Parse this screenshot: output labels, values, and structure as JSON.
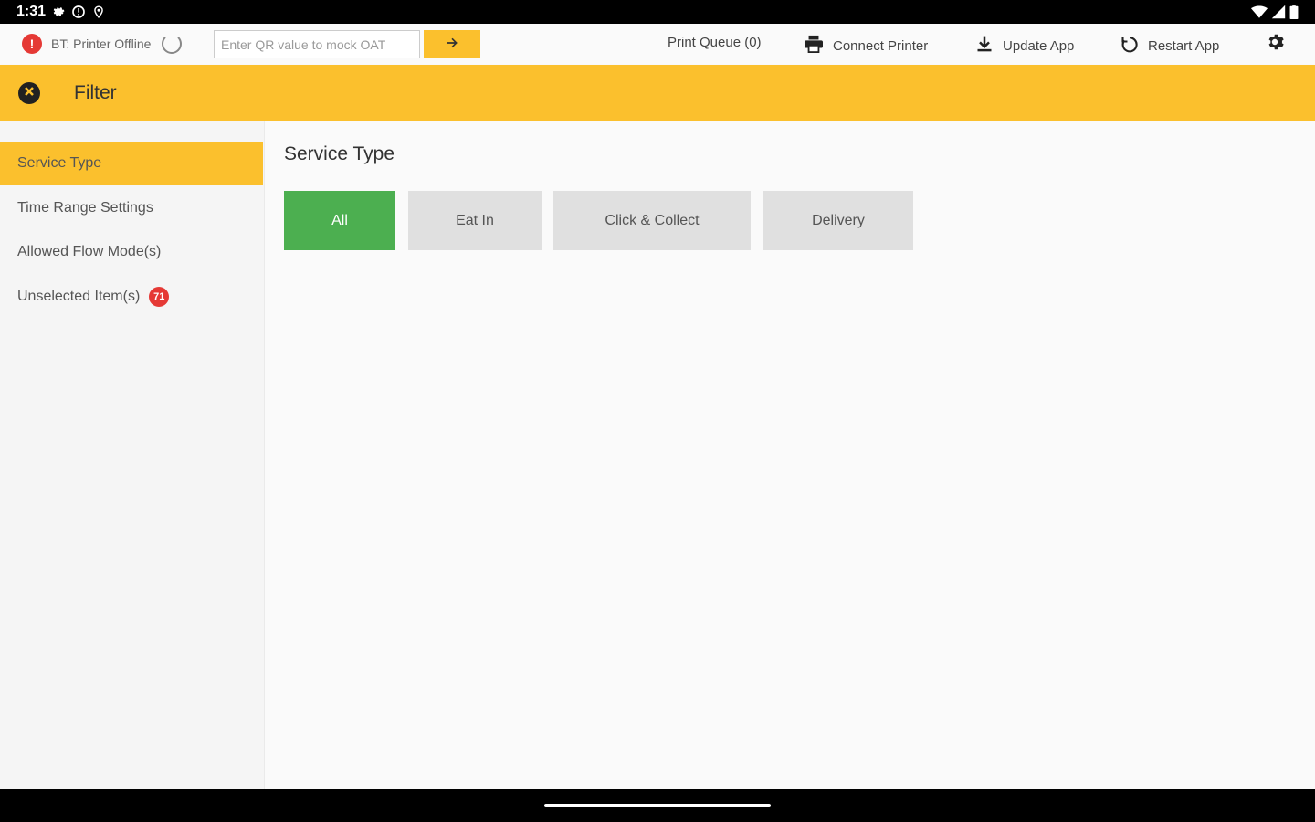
{
  "status_bar": {
    "time": "1:31",
    "left_icons": [
      "settings-gear-icon",
      "alert-circle-icon",
      "location-icon"
    ],
    "right_icons": [
      "wifi-icon",
      "cellular-signal-icon",
      "battery-icon"
    ]
  },
  "toolbar": {
    "bt_label": "BT: Printer Offline",
    "qr_placeholder": "Enter QR value to mock OAT",
    "print_queue_label": "Print Queue (0)",
    "connect_printer_label": "Connect Printer",
    "update_app_label": "Update App",
    "restart_app_label": "Restart App"
  },
  "header": {
    "title": "Filter"
  },
  "sidebar": {
    "items": [
      {
        "label": "Service Type",
        "active": true
      },
      {
        "label": "Time Range Settings",
        "active": false
      },
      {
        "label": "Allowed Flow Mode(s)",
        "active": false
      },
      {
        "label": "Unselected Item(s)",
        "active": false,
        "badge": "71"
      }
    ]
  },
  "main": {
    "section_title": "Service Type",
    "options": [
      {
        "label": "All",
        "selected": true
      },
      {
        "label": "Eat In",
        "selected": false
      },
      {
        "label": "Click & Collect",
        "selected": false
      },
      {
        "label": "Delivery",
        "selected": false
      }
    ]
  },
  "colors": {
    "accent": "#fbc02d",
    "selected": "#4caf50",
    "alert": "#e53935"
  }
}
